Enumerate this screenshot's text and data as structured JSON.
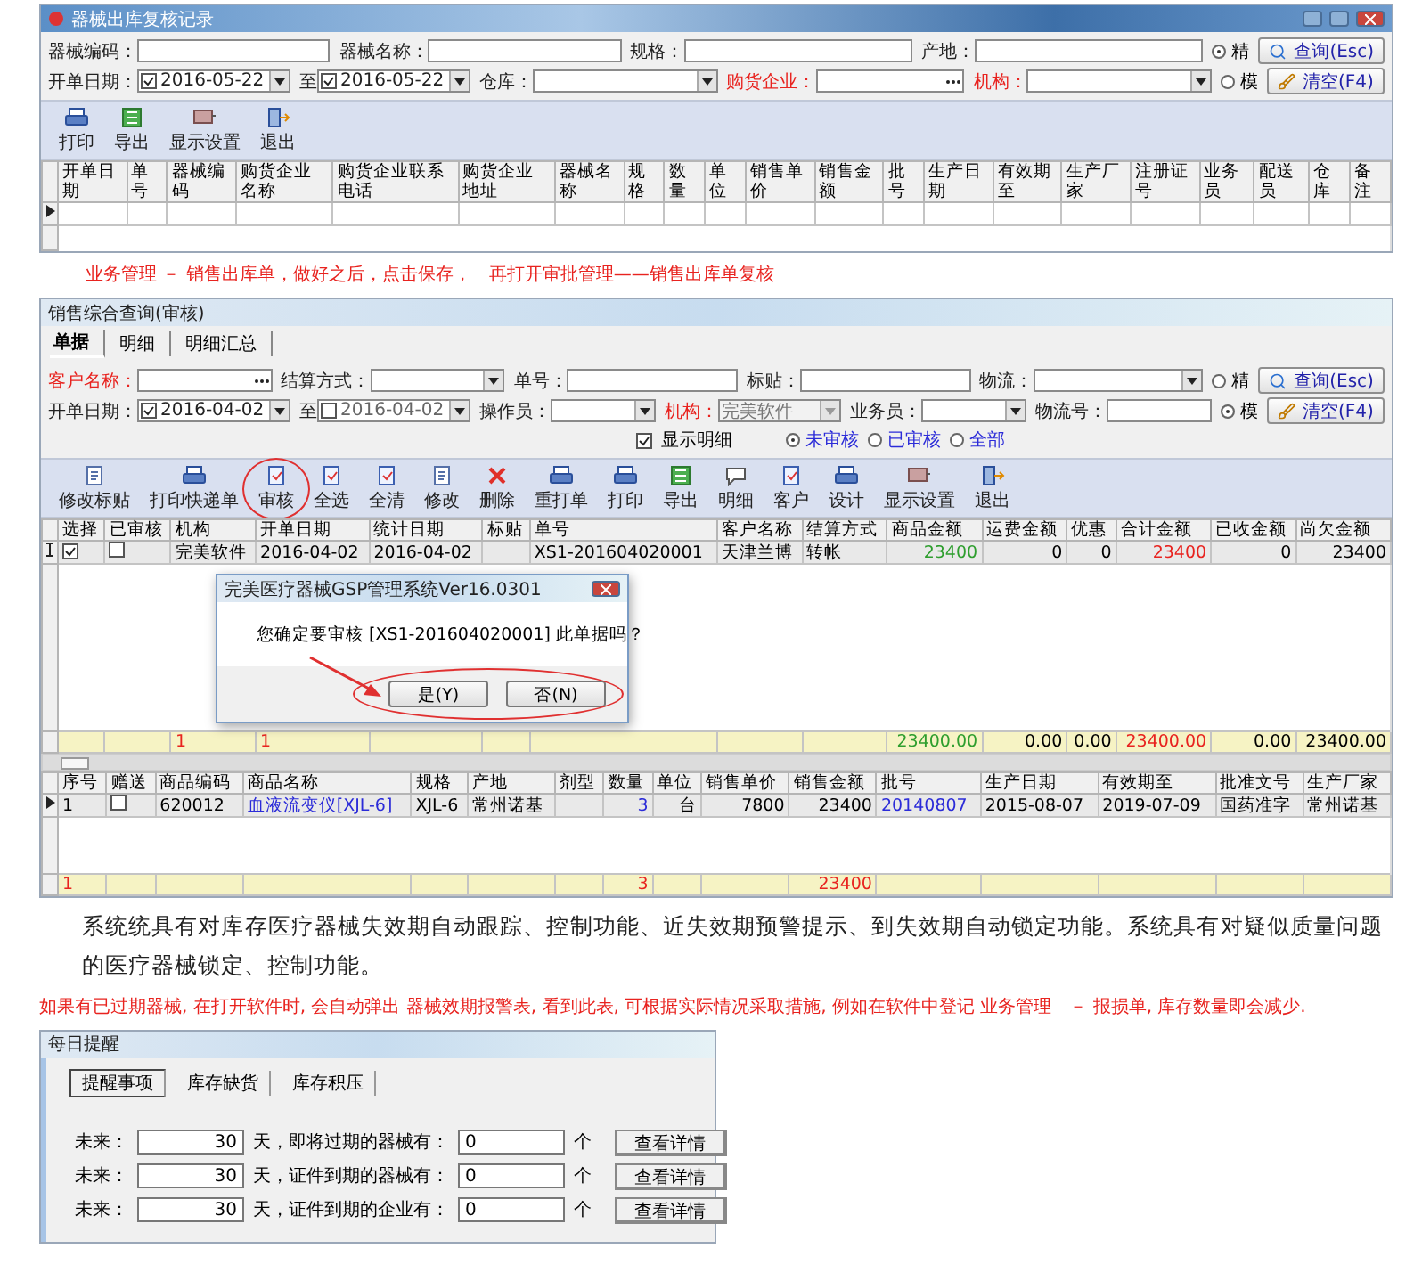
{
  "record_window": {
    "title": "器械出库复核记录",
    "filter_rows": [
      {
        "fields": [
          {
            "label": "器械编码：",
            "kind": "text",
            "highlight": false
          },
          {
            "label": "器械名称：",
            "kind": "text",
            "highlight": false
          },
          {
            "label": "规格：",
            "kind": "text",
            "highlight": false
          },
          {
            "label": "产地：",
            "kind": "text",
            "highlight": false
          }
        ],
        "radio": {
          "label": "精",
          "selected": true
        },
        "button": {
          "label": "查询(Esc)"
        }
      },
      {
        "fields": [
          {
            "label": "开单日期：",
            "kind": "date",
            "value": "2016-05-22",
            "checked": true,
            "highlight": false
          },
          {
            "label": "至",
            "kind": "date",
            "value": "2016-05-22",
            "checked": true,
            "highlight": false
          },
          {
            "label": "仓库：",
            "kind": "select",
            "highlight": false
          },
          {
            "label": "购货企业：",
            "kind": "lookup",
            "highlight": true
          },
          {
            "label": "机构：",
            "kind": "select",
            "highlight": true
          }
        ],
        "radio": {
          "label": "模",
          "selected": false
        },
        "button": {
          "label": "清空(F4)"
        }
      }
    ],
    "tools": [
      {
        "label": "打印"
      },
      {
        "label": "导出"
      },
      {
        "label": "显示设置"
      },
      {
        "label": "退出"
      }
    ],
    "columns": [
      "开单日期",
      "单号",
      "器械编码",
      "购货企业名称",
      "购货企业联系电话",
      "购货企业地址",
      "器械名称",
      "规格",
      "数量",
      "单位",
      "销售单价",
      "销售金额",
      "批号",
      "生产日期",
      "有效期至",
      "生产厂家",
      "注册证号",
      "业务员",
      "配送员",
      "仓库",
      "备注"
    ]
  },
  "step_note": "业务管理 － 销售出库单，做好之后，点击保存，　再打开审批管理——销售出库单复核",
  "audit_window": {
    "title": "销售综合查询(审核)",
    "tabs": [
      {
        "label": "单据",
        "selected": true
      },
      {
        "label": "明细",
        "selected": false
      },
      {
        "label": "明细汇总",
        "selected": false
      }
    ],
    "filter_rows": [
      {
        "fields": [
          {
            "label": "客户名称：",
            "kind": "lookup",
            "highlight": true
          },
          {
            "label": "结算方式：",
            "kind": "select",
            "highlight": false
          },
          {
            "label": "单号：",
            "kind": "text",
            "highlight": false
          },
          {
            "label": "标贴：",
            "kind": "text",
            "highlight": false
          },
          {
            "label": "物流：",
            "kind": "select",
            "highlight": false
          }
        ],
        "radio": {
          "label": "精",
          "selected": false
        },
        "button": {
          "label": "查询(Esc)"
        }
      },
      {
        "fields": [
          {
            "label": "开单日期：",
            "kind": "date",
            "value": "2016-04-02",
            "checked": true,
            "highlight": false
          },
          {
            "label": "至",
            "kind": "date",
            "value": "2016-04-02",
            "checked": false,
            "highlight": false
          },
          {
            "label": "操作员：",
            "kind": "select",
            "highlight": false
          },
          {
            "label": "机构：",
            "kind": "select",
            "value": "完美软件",
            "disabled": true,
            "highlight": true
          },
          {
            "label": "业务员：",
            "kind": "select",
            "highlight": false
          },
          {
            "label": "物流号：",
            "kind": "text",
            "highlight": false
          }
        ],
        "radio": {
          "label": "模",
          "selected": true
        },
        "button": {
          "label": "清空(F4)"
        }
      }
    ],
    "show_detail": {
      "label": "显示明细",
      "checked": true
    },
    "status_filter": [
      {
        "label": "未审核",
        "selected": true
      },
      {
        "label": "已审核",
        "selected": false
      },
      {
        "label": "全部",
        "selected": false
      }
    ],
    "tools": [
      {
        "label": "修改标贴"
      },
      {
        "label": "打印快递单"
      },
      {
        "label": "审核"
      },
      {
        "label": "全选"
      },
      {
        "label": "全清"
      },
      {
        "label": "修改"
      },
      {
        "label": "删除"
      },
      {
        "label": "重打单"
      },
      {
        "label": "打印"
      },
      {
        "label": "导出"
      },
      {
        "label": "明细"
      },
      {
        "label": "客户"
      },
      {
        "label": "设计"
      },
      {
        "label": "显示设置"
      },
      {
        "label": "退出"
      }
    ],
    "upper_table": {
      "columns": [
        {
          "label": "选择",
          "kind": "text"
        },
        {
          "label": "已审核",
          "kind": "text"
        },
        {
          "label": "机构",
          "kind": "text"
        },
        {
          "label": "开单日期",
          "kind": "text"
        },
        {
          "label": "统计日期",
          "kind": "text"
        },
        {
          "label": "标贴",
          "kind": "text"
        },
        {
          "label": "单号",
          "kind": "text"
        },
        {
          "label": "客户名称",
          "kind": "text"
        },
        {
          "label": "结算方式",
          "kind": "text"
        },
        {
          "label": "商品金额",
          "kind": "number"
        },
        {
          "label": "运费金额",
          "kind": "number"
        },
        {
          "label": "优惠",
          "kind": "number"
        },
        {
          "label": "合计金额",
          "kind": "number"
        },
        {
          "label": "已收金额",
          "kind": "number"
        },
        {
          "label": "尚欠金额",
          "kind": "number"
        }
      ],
      "rows": [
        [
          {
            "kind": "check",
            "checked": true
          },
          {
            "kind": "check",
            "checked": false
          },
          "完美软件",
          "2016-04-02",
          "2016-04-02",
          null,
          "XS1-201604020001",
          "天津兰博",
          "转帐",
          {
            "text": "23400",
            "color": "#2e9e2e"
          },
          "0",
          "0",
          {
            "text": "23400",
            "color": "#e8231f"
          },
          "0",
          "23400"
        ]
      ],
      "totals": {
        "branch_count": {
          "text": "1",
          "color": "#e8231f"
        },
        "order_count": {
          "text": "1",
          "color": "#e8231f"
        },
        "goods_amount": {
          "text": "23400.00",
          "color": "#2e9e2e"
        },
        "freight": "0.00",
        "discount": "0.00",
        "total_amount": {
          "text": "23400.00",
          "color": "#e8231f"
        },
        "received": "0.00",
        "owed": "23400.00"
      }
    },
    "dialog": {
      "title": "完美医疗器械GSP管理系统Ver16.0301",
      "message": "您确定要审核 [XS1-201604020001] 此单据吗？",
      "buttons": [
        "是(Y)",
        "否(N)"
      ]
    },
    "lower_table": {
      "columns": [
        {
          "label": "序号",
          "kind": "text"
        },
        {
          "label": "赠送",
          "kind": "text"
        },
        {
          "label": "商品编码",
          "kind": "text"
        },
        {
          "label": "商品名称",
          "kind": "text"
        },
        {
          "label": "规格",
          "kind": "text"
        },
        {
          "label": "产地",
          "kind": "text"
        },
        {
          "label": "剂型",
          "kind": "text"
        },
        {
          "label": "数量",
          "kind": "number"
        },
        {
          "label": "单位",
          "kind": "number"
        },
        {
          "label": "销售单价",
          "kind": "number"
        },
        {
          "label": "销售金额",
          "kind": "number"
        },
        {
          "label": "批号",
          "kind": "text"
        },
        {
          "label": "生产日期",
          "kind": "text"
        },
        {
          "label": "有效期至",
          "kind": "text"
        },
        {
          "label": "批准文号",
          "kind": "text"
        },
        {
          "label": "生产厂家",
          "kind": "text"
        }
      ],
      "rows": [
        [
          "1",
          {
            "kind": "check",
            "checked": false
          },
          "620012",
          {
            "text": "血液流变仪[XJL-6]",
            "color": "#2b2bd8"
          },
          "XJL-6",
          "常州诺基",
          null,
          {
            "text": "3",
            "color": "#2b2bd8"
          },
          "台",
          "7800",
          "23400",
          {
            "text": "20140807",
            "color": "#2b2bd8"
          },
          "2015-08-07",
          "2019-07-09",
          "国药准字",
          "常州诺基"
        ]
      ],
      "totals": {
        "line_count": {
          "text": "1",
          "color": "#e8231f"
        },
        "quantity": {
          "text": "3",
          "color": "#e8231f"
        },
        "sales_amount": {
          "text": "23400",
          "color": "#e8231f"
        }
      }
    }
  },
  "feature_text": "系统统具有对库存医疗器械失效期自动跟踪、控制功能、近失效期预警提示、到失效期自动锁定功能。系统具有对疑似质量问题的医疗器械锁定、控制功能。",
  "expiry_note": "如果有已过期器械, 在打开软件时, 会自动弹出 器械效期报警表, 看到此表, 可根据实际情况采取措施, 例如在软件中登记 业务管理　－ 报损单, 库存数量即会减少.",
  "reminder_window": {
    "title": "每日提醒",
    "tabs": [
      {
        "label": "提醒事项",
        "selected": true
      },
      {
        "label": "库存缺货",
        "selected": false
      },
      {
        "label": "库存积压",
        "selected": false
      }
    ],
    "rows": [
      {
        "prefix": "未来：",
        "days": "30",
        "text": "天，即将过期的器械有：",
        "count": "0",
        "unit": "个",
        "button": "查看详情"
      },
      {
        "prefix": "未来：",
        "days": "30",
        "text": "天，证件到期的器械有：",
        "count": "0",
        "unit": "个",
        "button": "查看详情"
      },
      {
        "prefix": "未来：",
        "days": "30",
        "text": "天，证件到期的企业有：",
        "count": "0",
        "unit": "个",
        "button": "查看详情"
      }
    ]
  }
}
